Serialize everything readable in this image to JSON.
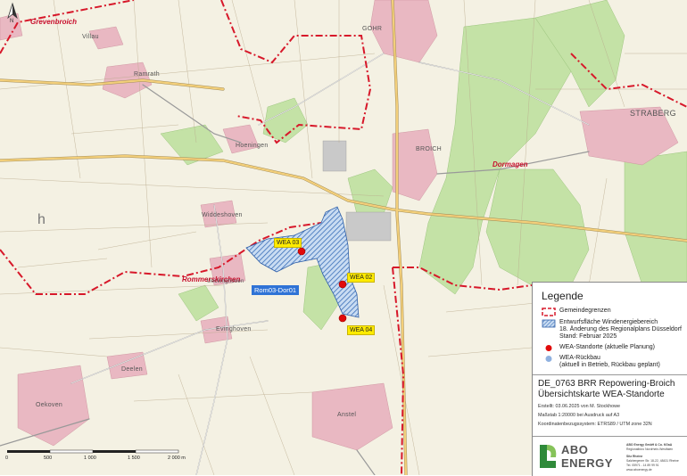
{
  "map": {
    "north_label": "N",
    "towns": [
      "Grevenbroich",
      "Villau",
      "Ramrath",
      "GOHR",
      "STRABERG",
      "Hoeningen",
      "BROICH",
      "Dormagen",
      "Widdeshoven",
      "Rommerskirchen",
      "Ueckinghoven",
      "Evinghoven",
      "Deelen",
      "Oekoven",
      "Anstel",
      "h"
    ],
    "turbines": [
      {
        "label": "WEA 03",
        "status": "planned"
      },
      {
        "label": "WEA 02",
        "status": "planned"
      },
      {
        "label": "WEA 04",
        "status": "planned"
      }
    ],
    "area_tag": "Rom03-Dor01",
    "scale": {
      "ticks": [
        "0",
        "500",
        "1 000",
        "1 500",
        "2 000 m"
      ]
    }
  },
  "legend": {
    "title": "Legende",
    "items": [
      {
        "text": "Gemeindegrenzen"
      },
      {
        "text": "Entwurfsfläche Windenergiebereich"
      },
      {
        "text": "18. Änderung des Regionalplans Düsseldorf"
      },
      {
        "text": "Stand: Februar 2025"
      },
      {
        "text": "WEA-Standorte (aktuelle Planung)"
      },
      {
        "text": "WEA-Rückbau"
      },
      {
        "text": "(aktuell in Betrieb, Rückbau geplant)"
      }
    ]
  },
  "project": {
    "title_line1": "DE_0763 BRR Repowering-Broich",
    "title_line2": "Übersichtskarte WEA-Standorte",
    "created": "Erstellt: 03.06.2025 von M. Stockhowe",
    "scale": "Maßstab 1:20000  bei Ausdruck auf A3",
    "crs": "Koordinatenbezugssystem: ETRS89 / UTM zone 32N"
  },
  "logo": {
    "line1": "ABO",
    "line2": "ENERGY"
  },
  "company": {
    "name": "ABO Energy GmbH & Co. KGaA",
    "sub": "Regionalbüro Nordrhein-Westfalen",
    "addr1": "Sitz Rheine",
    "addr2": "Salzbergener Str. 18-22, 48431 Rheine",
    "phone": "Tel. 05971 - 14 89 99 91",
    "web": "www.aboenergy.de"
  },
  "colors": {
    "boundary": "#d7182a",
    "area_fill": "#7aa6d6",
    "planned": "#e10b0b",
    "removal": "#8fb1e0",
    "forest": "#bfe0a0",
    "road": "#f2c96a"
  }
}
